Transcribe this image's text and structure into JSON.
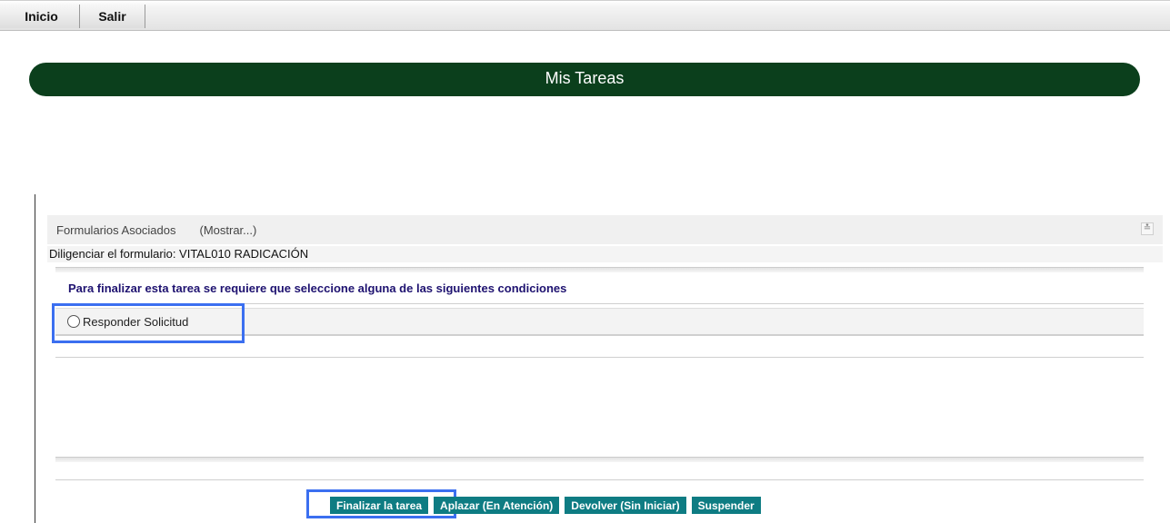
{
  "nav": {
    "inicio": "Inicio",
    "salir": "Salir"
  },
  "header": {
    "title": "Mis Tareas"
  },
  "forms": {
    "label": "Formularios Asociados",
    "toggle": "(Mostrar...)",
    "expand_icon": "double-chevron-down-icon",
    "form_line": "Diligenciar el formulario: VITAL010 RADICACIÓN"
  },
  "instruction": "Para finalizar esta tarea se requiere que seleccione alguna de las siguientes condiciones",
  "conditions": [
    {
      "label": "Responder Solicitud",
      "selected": false
    }
  ],
  "actions": {
    "finalize": "Finalizar la tarea",
    "postpone": "Aplazar (En Atención)",
    "return": "Devolver (Sin Iniciar)",
    "suspend": "Suspender"
  },
  "colors": {
    "header_bg": "#0b3f1c",
    "button_bg": "#0e7c83",
    "instruction_text": "#1e1270",
    "highlight": "#3b6ff0"
  }
}
